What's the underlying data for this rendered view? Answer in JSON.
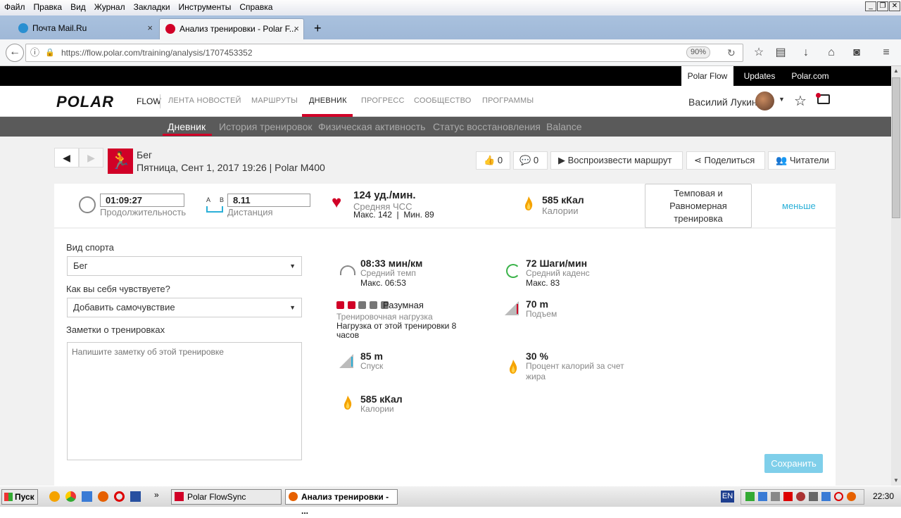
{
  "menu": [
    "Файл",
    "Правка",
    "Вид",
    "Журнал",
    "Закладки",
    "Инструменты",
    "Справка"
  ],
  "tabs": [
    {
      "label": "Почта Mail.Ru",
      "close": "×"
    },
    {
      "label": "Анализ тренировки - Polar F...",
      "close": "×"
    }
  ],
  "new_tab": "+",
  "url": "https://flow.polar.com/training/analysis/1707453352",
  "zoom": "90%",
  "polar_top": {
    "flow": "Polar Flow",
    "updates": "Updates",
    "site": "Polar.com"
  },
  "brand": {
    "logo": "POLAR",
    "flow": "FLOW"
  },
  "nav": [
    "ЛЕНТА НОВОСТЕЙ",
    "МАРШРУТЫ",
    "ДНЕВНИК",
    "ПРОГРЕСС",
    "СООБЩЕСТВО",
    "ПРОГРАММЫ"
  ],
  "user": {
    "name": "Василий Лукин"
  },
  "subnav": [
    "Дневник",
    "История тренировок",
    "Физическая активность",
    "Статус восстановления",
    "Balance"
  ],
  "session": {
    "sport": "Бег",
    "date": "Пятница, Сент 1, 2017 19:26 | Polar M400"
  },
  "actions": {
    "likes": "0",
    "comments": "0",
    "replay": "Воспроизвести маршрут",
    "share": "Поделиться",
    "readers": "Читатели"
  },
  "summary": {
    "duration": "01:09:27",
    "duration_label": "Продолжительность",
    "ab_a": "A",
    "ab_b": "B",
    "distance": "8.11",
    "distance_label": "Дистанция",
    "hr": "124 уд./мин.",
    "hr_label": "Средняя ЧСС",
    "hr_minmax": "Макс. 142  |  Мин. 89",
    "cal": "585 кКал",
    "cal_label": "Калории",
    "benefit": "Темповая и Равномерная тренировка",
    "less": "меньше"
  },
  "form": {
    "sport_label": "Вид спорта",
    "sport_value": "Бег",
    "feel_label": "Как вы себя чувствуете?",
    "feel_value": "Добавить самочувствие",
    "notes_label": "Заметки о тренировках",
    "notes_placeholder": "Напишите заметку об этой тренировке"
  },
  "stats": {
    "pace": "08:33 мин/км",
    "pace_label": "Средний темп",
    "pace_max": "Макс. 06:53",
    "cadence": "72 Шаги/мин",
    "cadence_label": "Средний каденс",
    "cadence_max": "Макс. 83",
    "load_level": "Разумная",
    "load_label": "Тренировочная нагрузка",
    "load_desc": "Нагрузка от этой тренировки 8 часов",
    "ascent": "70 m",
    "ascent_label": "Подъем",
    "descent": "85 m",
    "descent_label": "Спуск",
    "fat": "30 %",
    "fat_label": "Процент калорий за счет жира",
    "cal2": "585 кКал",
    "cal2_label": "Калории"
  },
  "save": "Сохранить",
  "taskbar": {
    "start": "Пуск",
    "flowsync": "Polar FlowSync",
    "active": "Анализ тренировки - ...",
    "lang": "EN",
    "clock": "22:30"
  },
  "colors": {
    "accent": "#d10027",
    "link": "#2bb0d8",
    "save_btn": "#7fcfea"
  }
}
